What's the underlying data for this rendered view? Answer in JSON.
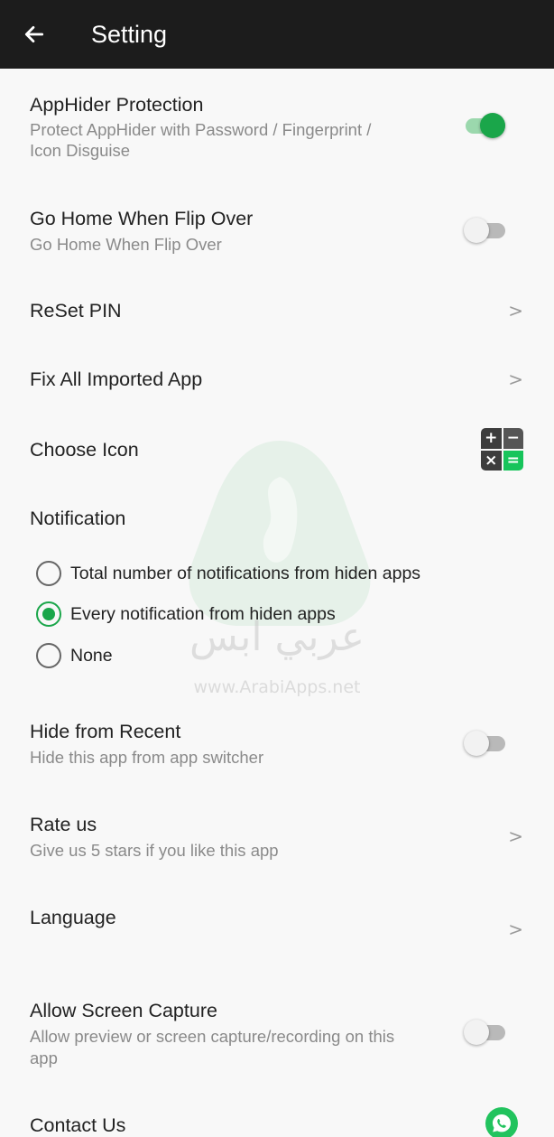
{
  "appbar": {
    "title": "Setting",
    "back_icon": "arrow-left-icon"
  },
  "settings": {
    "protection": {
      "title": "AppHider Protection",
      "subtitle_line1": "Protect AppHider with Password / Fingerprint /",
      "subtitle_line2": "Icon Disguise",
      "enabled": true
    },
    "flip": {
      "title": "Go Home When Flip Over",
      "subtitle": "Go Home When Flip Over",
      "enabled": false
    },
    "reset_pin": {
      "title": "ReSet PIN"
    },
    "fix_imported": {
      "title": "Fix All Imported App"
    },
    "choose_icon": {
      "title": "Choose Icon",
      "icon_symbols": [
        "+",
        "−",
        "×",
        "="
      ]
    },
    "notification": {
      "title": "Notification",
      "options": [
        {
          "label": "Total number of notifications from hiden apps",
          "selected": false
        },
        {
          "label": "Every notification from hiden apps",
          "selected": true
        },
        {
          "label": "None",
          "selected": false
        }
      ]
    },
    "hide_recent": {
      "title": "Hide from Recent",
      "subtitle": "Hide this app from app switcher",
      "enabled": false
    },
    "rate": {
      "title": "Rate us",
      "subtitle": "Give us 5 stars if you like this app"
    },
    "language": {
      "title": "Language"
    },
    "screen_capture": {
      "title": "Allow Screen Capture",
      "subtitle_line1": "Allow preview or screen capture/recording on this",
      "subtitle_line2": "app",
      "enabled": false
    },
    "contact": {
      "title": "Contact Us",
      "icon": "whatsapp-icon"
    }
  },
  "chevron": ">",
  "watermark": {
    "arabic": "عربي ابس",
    "url": "www.ArabiApps.net"
  },
  "colors": {
    "accent": "#1aa64a",
    "appbar": "#1c1c1c",
    "background": "#f8f8f8"
  }
}
